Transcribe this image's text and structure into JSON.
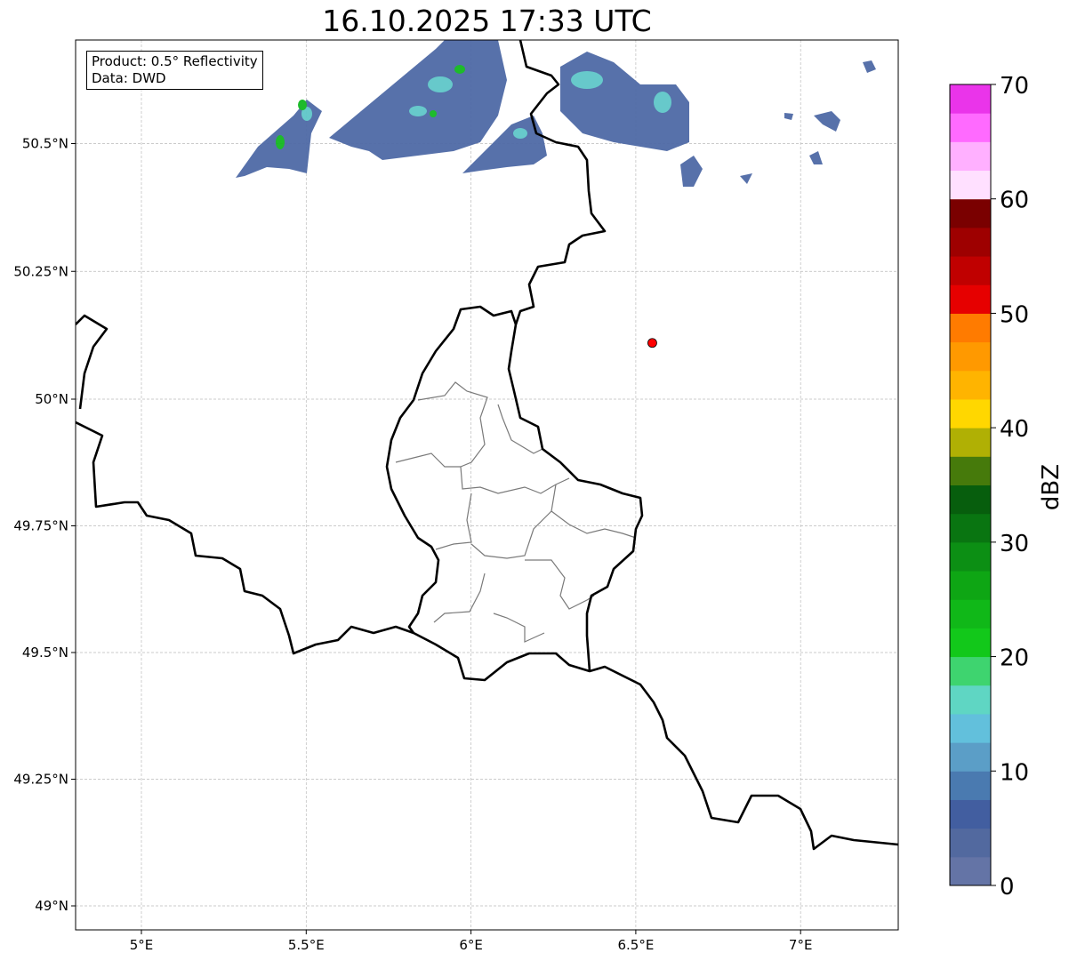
{
  "title": "16.10.2025 17:33 UTC",
  "info_box": {
    "product": "Product: 0.5° Reflectivity",
    "data": "Data: DWD"
  },
  "map": {
    "lon_ticks": [
      {
        "value": 5,
        "label": "5°E"
      },
      {
        "value": 5.5,
        "label": "5.5°E"
      },
      {
        "value": 6,
        "label": "6°E"
      },
      {
        "value": 6.5,
        "label": "6.5°E"
      },
      {
        "value": 7,
        "label": "7°E"
      }
    ],
    "lat_ticks": [
      {
        "value": 50.5,
        "label": "50.5°N"
      },
      {
        "value": 50.25,
        "label": "50.25°N"
      },
      {
        "value": 50,
        "label": "50°N"
      },
      {
        "value": 49.75,
        "label": "49.75°N"
      },
      {
        "value": 49.5,
        "label": "49.5°N"
      },
      {
        "value": 49.25,
        "label": "49.25°N"
      },
      {
        "value": 49,
        "label": "49°N"
      }
    ],
    "marker": {
      "lon": 6.55,
      "lat": 50.11,
      "color": "#ff0000"
    }
  },
  "colorbar": {
    "label": "dBZ",
    "min": 0,
    "max": 70,
    "step": 2.5,
    "ticks": [
      {
        "value": 0,
        "label": "0"
      },
      {
        "value": 10,
        "label": "10"
      },
      {
        "value": 20,
        "label": "20"
      },
      {
        "value": 30,
        "label": "30"
      },
      {
        "value": 40,
        "label": "40"
      },
      {
        "value": 50,
        "label": "50"
      },
      {
        "value": 60,
        "label": "60"
      },
      {
        "value": 70,
        "label": "70"
      }
    ],
    "colors": [
      "#6474a6",
      "#52699f",
      "#425ea0",
      "#4a7ab0",
      "#5b9ec7",
      "#62c0dc",
      "#5fd6c3",
      "#3ed46f",
      "#12c81a",
      "#10b818",
      "#0ea614",
      "#0c8f14",
      "#097511",
      "#075e0d",
      "#467a0b",
      "#b0b004",
      "#ffd700",
      "#ffb400",
      "#ff9900",
      "#ff7b00",
      "#e60000",
      "#c00000",
      "#9e0000",
      "#7a0000",
      "#ffe0ff",
      "#ffb0ff",
      "#ff6aff",
      "#ea34ea"
    ]
  }
}
